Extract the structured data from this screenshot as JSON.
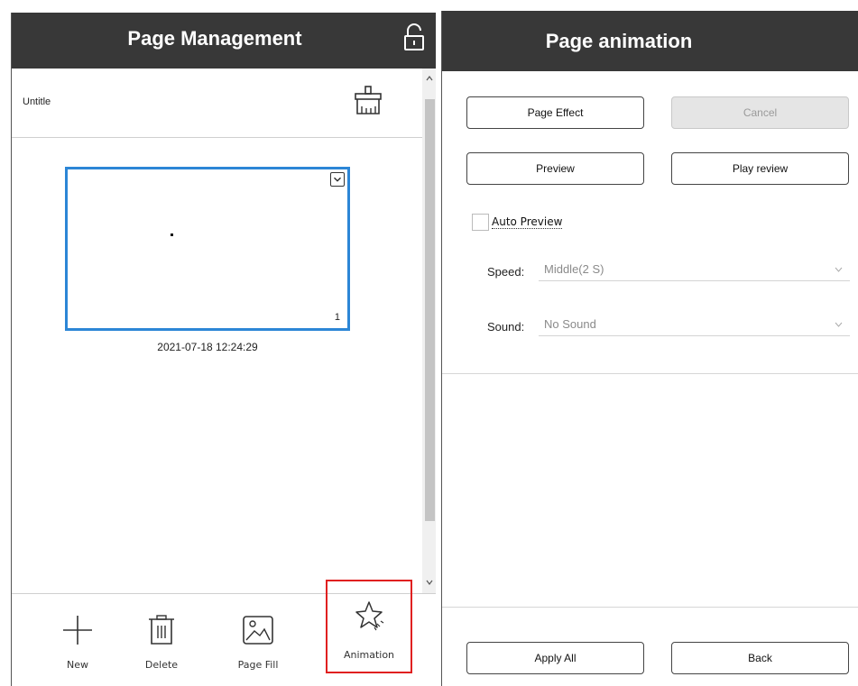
{
  "left_panel": {
    "title": "Page Management",
    "document_name": "Untitle",
    "page_thumbnail": {
      "page_number": "1",
      "timestamp": "2021-07-18 12:24:29"
    },
    "toolbar": [
      {
        "label": "New",
        "icon": "plus-icon"
      },
      {
        "label": "Delete",
        "icon": "trash-icon"
      },
      {
        "label": "Page Fill",
        "icon": "image-icon"
      },
      {
        "label": "Animation",
        "icon": "star-icon"
      }
    ],
    "highlight_color": "#e02020",
    "selection_color": "#2c86d6"
  },
  "right_panel": {
    "title": "Page animation",
    "buttons": {
      "page_effect": "Page Effect",
      "cancel": "Cancel",
      "preview": "Preview",
      "play_review": "Play review",
      "apply_all": "Apply All",
      "back": "Back"
    },
    "auto_preview": {
      "label": "Auto Preview",
      "checked": false
    },
    "speed": {
      "label": "Speed:",
      "value": "Middle(2 S)"
    },
    "sound": {
      "label": "Sound:",
      "value": "No Sound"
    }
  },
  "colors": {
    "header_bg": "#383838",
    "header_text": "#ffffff"
  }
}
